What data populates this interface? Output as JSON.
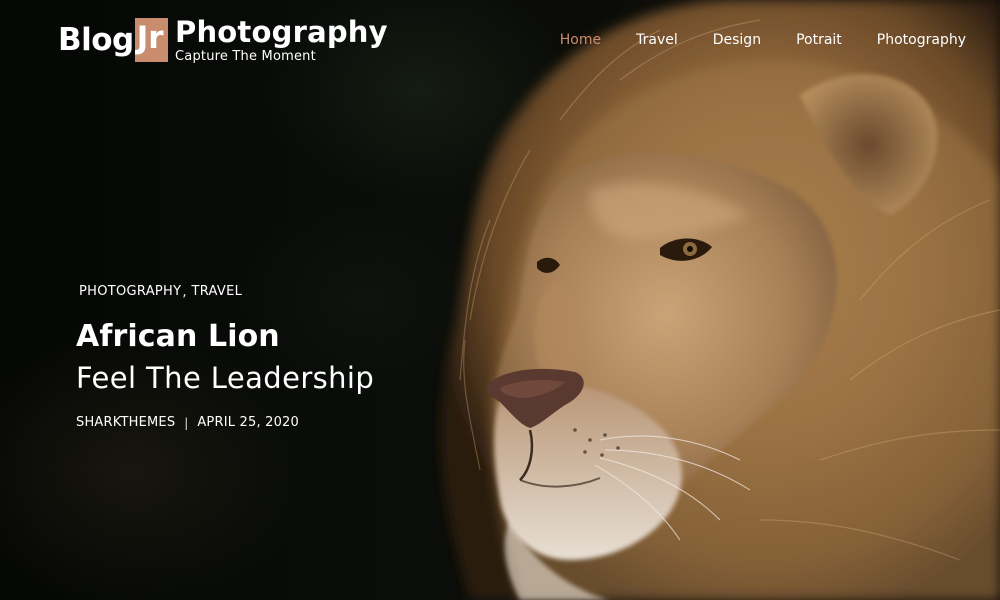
{
  "header": {
    "logo": {
      "part1": "Blog",
      "part2": "Jr"
    },
    "site_title": "Photography",
    "tagline": "Capture The Moment",
    "nav": [
      {
        "label": "Home",
        "active": true
      },
      {
        "label": "Travel",
        "active": false
      },
      {
        "label": "Design",
        "active": false
      },
      {
        "label": "Potrait",
        "active": false
      },
      {
        "label": "Photography",
        "active": false
      }
    ]
  },
  "post": {
    "categories": [
      "PHOTOGRAPHY",
      "TRAVEL"
    ],
    "category_separator": ",",
    "title": "African Lion",
    "subtitle": "Feel The Leadership",
    "author": "SHARKTHEMES",
    "meta_separator": "|",
    "date": "APRIL 25, 2020"
  },
  "hero_image": {
    "subject": "lion-photo"
  },
  "colors": {
    "accent": "#c98d6e",
    "text": "#ffffff",
    "background": "#060806"
  }
}
